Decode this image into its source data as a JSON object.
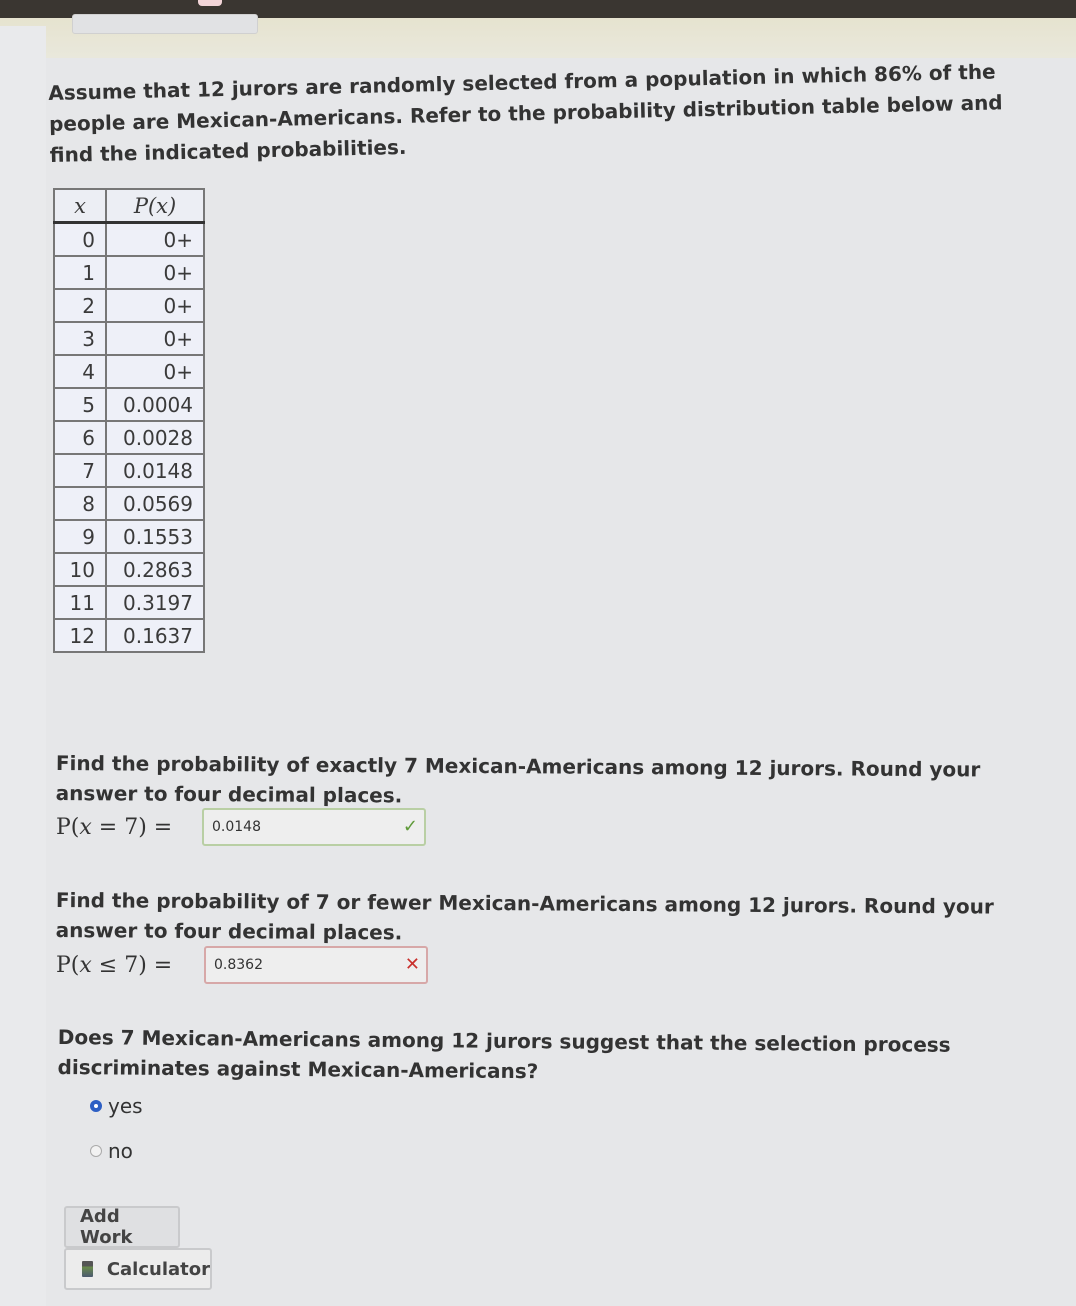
{
  "intro": "Assume that 12 jurors are randomly selected from a population in which 86% of the people are Mexican-Americans. Refer to the probability distribution table below and find the indicated probabilities.",
  "table": {
    "headers": [
      "x",
      "P(x)"
    ],
    "rows": [
      {
        "x": "0",
        "p": "0+"
      },
      {
        "x": "1",
        "p": "0+"
      },
      {
        "x": "2",
        "p": "0+"
      },
      {
        "x": "3",
        "p": "0+"
      },
      {
        "x": "4",
        "p": "0+"
      },
      {
        "x": "5",
        "p": "0.0004"
      },
      {
        "x": "6",
        "p": "0.0028"
      },
      {
        "x": "7",
        "p": "0.0148"
      },
      {
        "x": "8",
        "p": "0.0569"
      },
      {
        "x": "9",
        "p": "0.1553"
      },
      {
        "x": "10",
        "p": "0.2863"
      },
      {
        "x": "11",
        "p": "0.3197"
      },
      {
        "x": "12",
        "p": "0.1637"
      }
    ]
  },
  "questions": [
    {
      "prompt": "Find the probability of exactly 7 Mexican-Americans among 12 jurors. Round your answer to four decimal places.",
      "label_prefix": "P(",
      "label_var": "x",
      "label_suffix": " = 7) =",
      "answer": "0.0148",
      "status": "correct",
      "status_icon": "✓"
    },
    {
      "prompt": "Find the probability of 7 or fewer Mexican-Americans among 12 jurors. Round your answer to four decimal places.",
      "label_prefix": "P(",
      "label_var": "x",
      "label_suffix": " ≤ 7) =",
      "answer": "0.8362",
      "status": "incorrect",
      "status_icon": "✕"
    },
    {
      "prompt": "Does 7 Mexican-Americans among 12 jurors suggest that the selection process discriminates against Mexican-Americans?",
      "options": [
        {
          "label": "yes",
          "selected": true
        },
        {
          "label": "no",
          "selected": false
        }
      ]
    }
  ],
  "buttons": {
    "add_work": "Add Work",
    "calculator": "Calculator"
  },
  "colors": {
    "correct": "#5f9a39",
    "incorrect": "#c9302c",
    "radio_selected": "#2d5fc4"
  }
}
